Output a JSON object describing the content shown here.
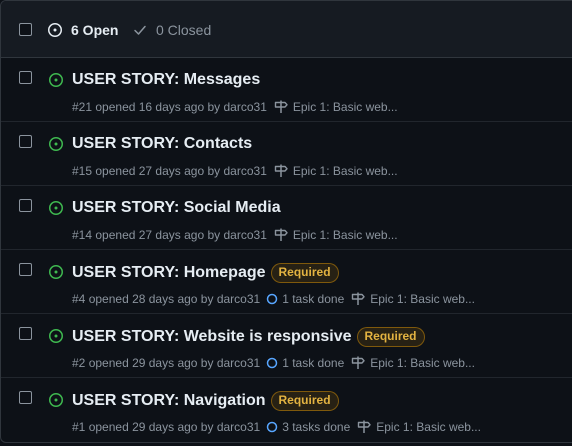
{
  "header": {
    "open_label": "6 Open",
    "closed_label": "0 Closed"
  },
  "colors": {
    "open_green": "#3fb950",
    "label_required": "#e3b341",
    "task_ring": "#58a6ff"
  },
  "issues": [
    {
      "title": "USER STORY: Messages",
      "number": "#21",
      "opened": "opened 16 days ago by",
      "author": "darco31",
      "required": "",
      "tasks": "",
      "milestone": "Epic 1: Basic web..."
    },
    {
      "title": "USER STORY: Contacts",
      "number": "#15",
      "opened": "opened 27 days ago by",
      "author": "darco31",
      "required": "",
      "tasks": "",
      "milestone": "Epic 1: Basic web..."
    },
    {
      "title": "USER STORY: Social Media",
      "number": "#14",
      "opened": "opened 27 days ago by",
      "author": "darco31",
      "required": "",
      "tasks": "",
      "milestone": "Epic 1: Basic web..."
    },
    {
      "title": "USER STORY: Homepage",
      "number": "#4",
      "opened": "opened 28 days ago by",
      "author": "darco31",
      "required": "Required",
      "tasks": "1 task done",
      "milestone": "Epic 1: Basic web..."
    },
    {
      "title": "USER STORY: Website is responsive",
      "number": "#2",
      "opened": "opened 29 days ago by",
      "author": "darco31",
      "required": "Required",
      "tasks": "1 task done",
      "milestone": "Epic 1: Basic web..."
    },
    {
      "title": "USER STORY: Navigation",
      "number": "#1",
      "opened": "opened 29 days ago by",
      "author": "darco31",
      "required": "Required",
      "tasks": "3 tasks done",
      "milestone": "Epic 1: Basic web..."
    }
  ]
}
